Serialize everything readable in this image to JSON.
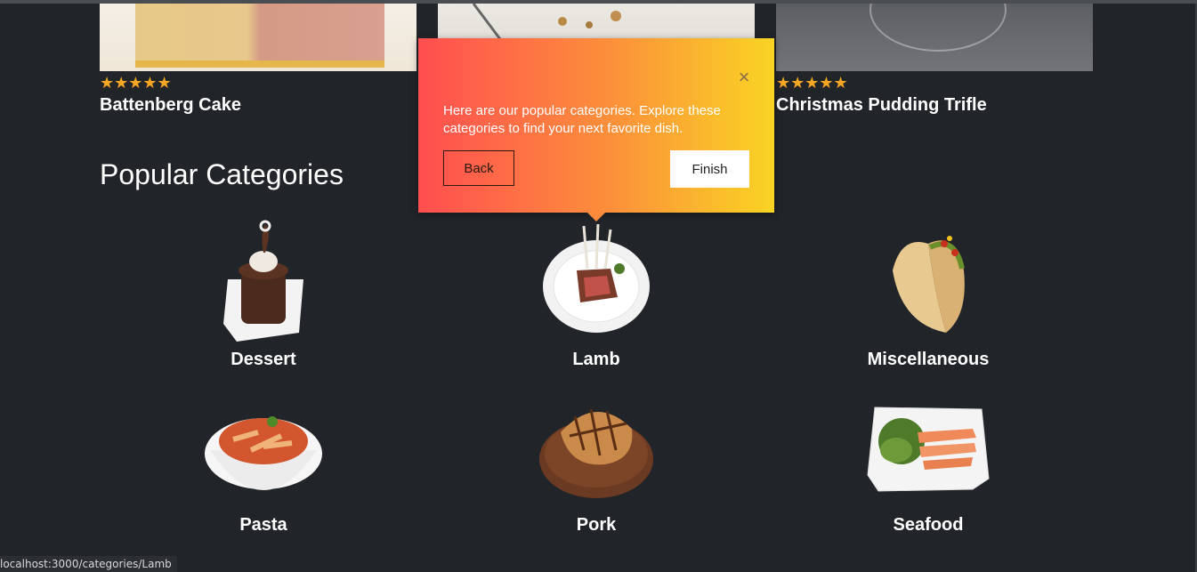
{
  "recipes": [
    {
      "title": "Battenberg Cake",
      "rating": "★★★★★"
    },
    {
      "title": "",
      "rating": ""
    },
    {
      "title": "Christmas Pudding Trifle",
      "rating": "★★★★★"
    }
  ],
  "section": {
    "title": "Popular Categories"
  },
  "categories": [
    {
      "label": "Dessert",
      "icon": "dessert-image"
    },
    {
      "label": "Lamb",
      "icon": "lamb-image"
    },
    {
      "label": "Miscellaneous",
      "icon": "taco-image"
    },
    {
      "label": "Pasta",
      "icon": "pasta-image"
    },
    {
      "label": "Pork",
      "icon": "pork-image"
    },
    {
      "label": "Seafood",
      "icon": "seafood-image"
    }
  ],
  "tour": {
    "text": "Here are our popular categories. Explore these categories to find your next favorite dish.",
    "back_label": "Back",
    "finish_label": "Finish",
    "close_icon": "×",
    "gradient": [
      "#ff4e50",
      "#fc913a",
      "#f9d423"
    ]
  },
  "status": {
    "url": "localhost:3000/categories/Lamb"
  },
  "colors": {
    "background": "#212529",
    "star": "#f5a623"
  }
}
